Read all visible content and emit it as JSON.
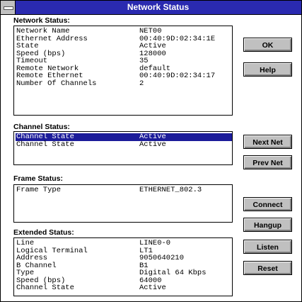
{
  "window": {
    "title": "Network Status"
  },
  "network_status": {
    "label": "Network Status:",
    "rows": [
      {
        "key": "Network Name",
        "value": "NET00"
      },
      {
        "key": "Ethernet Address",
        "value": "00:40:9D:02:34:1E"
      },
      {
        "key": "State",
        "value": "Active"
      },
      {
        "key": "Speed (bps)",
        "value": "128000"
      },
      {
        "key": "Timeout",
        "value": "35"
      },
      {
        "key": "Remote Network",
        "value": "default"
      },
      {
        "key": "Remote Ethernet",
        "value": "00:40:9D:02:34:17"
      },
      {
        "key": "Number Of Channels",
        "value": "2"
      }
    ]
  },
  "channel_status": {
    "label": "Channel Status:",
    "rows": [
      {
        "key": "Channel State",
        "value": "Active",
        "selected": true
      },
      {
        "key": "Channel State",
        "value": "Active"
      }
    ]
  },
  "frame_status": {
    "label": "Frame Status:",
    "rows": [
      {
        "key": "Frame Type",
        "value": "ETHERNET_802.3"
      }
    ]
  },
  "extended_status": {
    "label": "Extended Status:",
    "rows": [
      {
        "key": "Line",
        "value": "LINE0-0"
      },
      {
        "key": "Logical Terminal",
        "value": "LT1"
      },
      {
        "key": "Address",
        "value": "9050640210"
      },
      {
        "key": "B Channel",
        "value": "B1"
      },
      {
        "key": "Type",
        "value": "Digital 64 Kbps"
      },
      {
        "key": "Speed (bps)",
        "value": "64000"
      },
      {
        "key": "Channel State",
        "value": "Active"
      }
    ]
  },
  "buttons": {
    "ok": "OK",
    "help": "Help",
    "next_net": "Next Net",
    "prev_net": "Prev Net",
    "connect": "Connect",
    "hangup": "Hangup",
    "listen": "Listen",
    "reset": "Reset"
  },
  "colors": {
    "titlebar": "#2a2ab0",
    "selection": "#1c1c9a",
    "button_face": "#c0c0c0"
  }
}
